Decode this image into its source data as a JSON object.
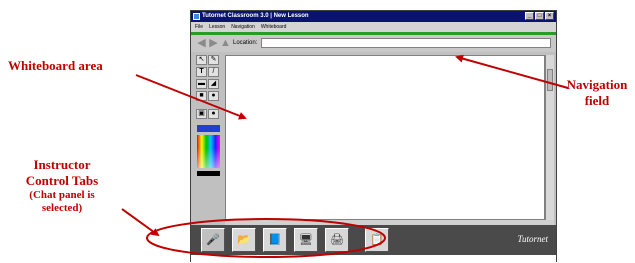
{
  "window": {
    "title": "Tutornet Classroom 3.0 | New Lesson",
    "menu": [
      "File",
      "Lesson",
      "Navigation",
      "Whiteboard"
    ],
    "controls": {
      "minimize": "_",
      "maximize": "□",
      "close": "×"
    }
  },
  "navigation": {
    "location_label": "Location:",
    "location_value": ""
  },
  "toolbar": {
    "tools": [
      {
        "icon": "select-arrow-icon",
        "glyph": "↖"
      },
      {
        "icon": "pencil-icon",
        "glyph": "✎"
      },
      {
        "icon": "text-tool-icon",
        "glyph": "T"
      },
      {
        "icon": "line-tool-icon",
        "glyph": "/"
      },
      {
        "icon": "eraser-icon",
        "glyph": "▬"
      },
      {
        "icon": "fill-bucket-icon",
        "glyph": "◢"
      },
      {
        "icon": "rectangle-tool-icon",
        "glyph": "■"
      },
      {
        "icon": "ellipse-tool-icon",
        "glyph": "●"
      },
      {
        "icon": "image-tool-icon",
        "glyph": "▣"
      },
      {
        "icon": "circle-fill-icon",
        "glyph": "●"
      }
    ]
  },
  "tabs": [
    {
      "icon": "chat-microphone-icon",
      "glyph": "🎤",
      "selected": true
    },
    {
      "icon": "folder-icon",
      "glyph": "📂",
      "selected": false
    },
    {
      "icon": "browser-book-icon",
      "glyph": "📘",
      "selected": false
    },
    {
      "icon": "presentation-icon",
      "glyph": "🖥",
      "selected": false
    },
    {
      "icon": "printer-icon",
      "glyph": "🖨",
      "selected": false
    },
    {
      "icon": "clipboard-icon",
      "glyph": "📋",
      "selected": false
    }
  ],
  "brand": "Tutornet",
  "annotations": {
    "whiteboard": "Whiteboard area",
    "navigation_line1": "Navigation",
    "navigation_line2": "field",
    "tabs_line1": "Instructor",
    "tabs_line2": "Control Tabs",
    "tabs_line3": "(Chat panel is",
    "tabs_line4": "selected)"
  },
  "colors": {
    "annotation_red": "#c00000",
    "title_bar": "#0a1470",
    "accent_green": "#2a9a28"
  }
}
